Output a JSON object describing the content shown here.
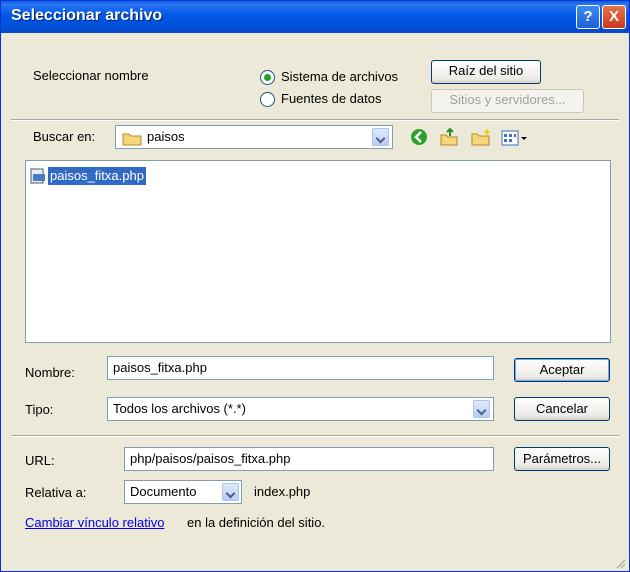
{
  "window": {
    "title": "Seleccionar archivo",
    "help_glyph": "?",
    "close_glyph": "X"
  },
  "select_name": {
    "label": "Seleccionar nombre",
    "option_filesystem": "Sistema de archivos",
    "option_datasources": "Fuentes de datos",
    "selected": "Sistema de archivos",
    "site_root_button": "Raíz del sitio",
    "sites_servers_button": "Sitios y servidores..."
  },
  "look_in": {
    "label": "Buscar en:",
    "value": "paisos",
    "folder_icon": "folder-icon"
  },
  "toolbar_icons": [
    "back-icon",
    "up-folder-icon",
    "new-folder-icon",
    "view-menu-icon"
  ],
  "files": [
    {
      "name": "paisos_fitxa.php",
      "icon": "php-file-icon",
      "selected": true
    }
  ],
  "name_field": {
    "label": "Nombre:",
    "value": "paisos_fitxa.php"
  },
  "type_field": {
    "label": "Tipo:",
    "value": "Todos los archivos (*.*)"
  },
  "buttons": {
    "accept": "Aceptar",
    "cancel": "Cancelar",
    "parameters": "Parámetros..."
  },
  "url_field": {
    "label": "URL:",
    "value": "php/paisos/paisos_fitxa.php"
  },
  "relative": {
    "label": "Relativa a:",
    "value": "Documento",
    "file": "index.php"
  },
  "footer": {
    "link": "Cambiar vínculo relativo",
    "text": "en la definición del sitio."
  }
}
